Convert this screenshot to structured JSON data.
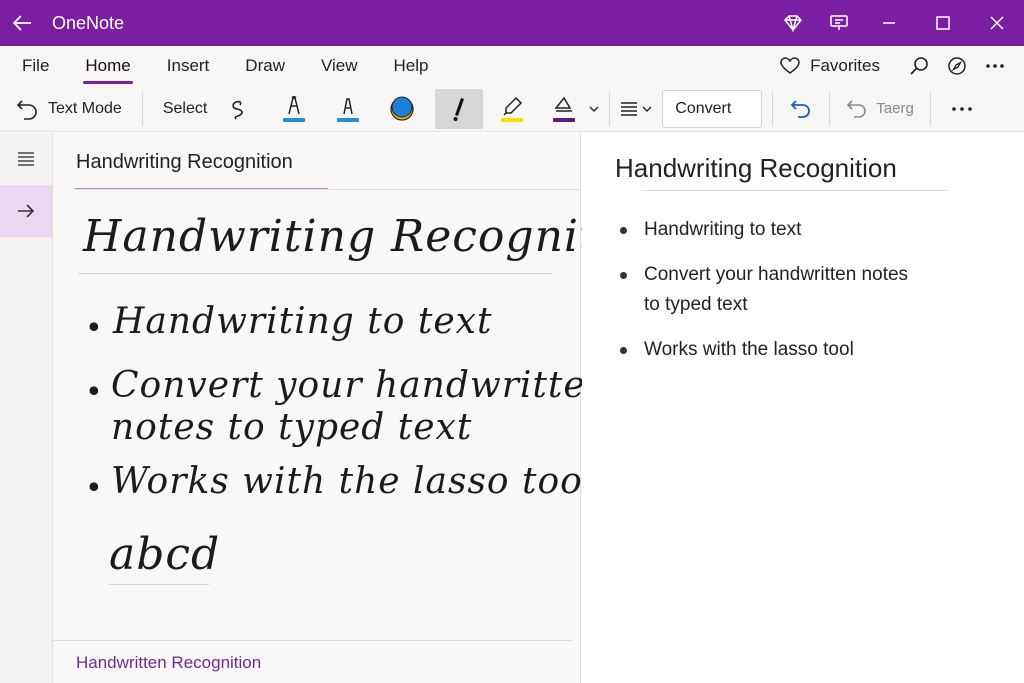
{
  "titlebar": {
    "app_title": "OneNote"
  },
  "menu": {
    "tabs": [
      "File",
      "Home",
      "Insert",
      "Draw",
      "View",
      "Help"
    ],
    "active_tab": "Home",
    "favorites_label": "Favorites"
  },
  "toolbar": {
    "text_mode_label": "Text Mode",
    "select_label": "Select",
    "convert_label": "Convert",
    "redo_label": "Taerg",
    "pen_colors": {
      "pen1": "#1e90d6",
      "pen2": "#1e90d6",
      "highlighter": "#f5e400",
      "pen_purple": "#5b1a7e"
    }
  },
  "page_pane": {
    "title": "Handwriting Recognition",
    "ink_heading": "Handwriting Recognition",
    "ink_items": [
      "Handwriting to text",
      "Convert your handwritten",
      "notes to typed text",
      "Works with the lasso tool"
    ],
    "ink_extra": "abcd",
    "footer_link": "Handwritten Recognition"
  },
  "typed_pane": {
    "title": "Handwriting Recognition",
    "items": [
      {
        "line1": "Handwriting to text",
        "line2": ""
      },
      {
        "line1": "Convert your handwritten notes",
        "line2": "to typed text"
      },
      {
        "line1": "Works with the lasso tool",
        "line2": ""
      }
    ]
  },
  "colors": {
    "accent": "#7a1fa2"
  }
}
